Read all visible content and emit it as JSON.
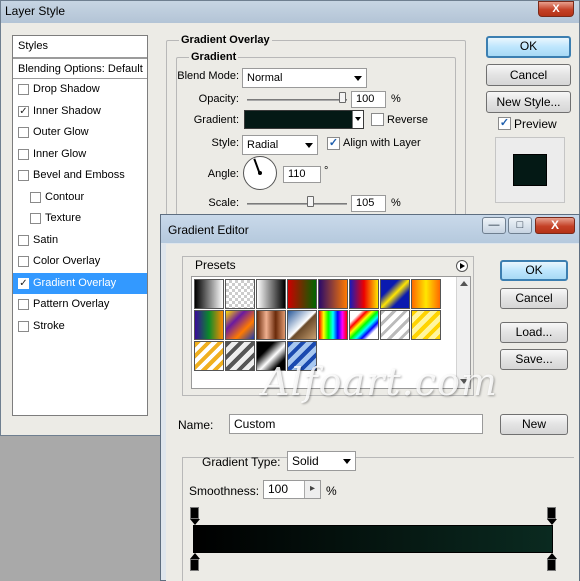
{
  "layer_style": {
    "title": "Layer Style",
    "close_glyph": "X",
    "styles_header": "Styles",
    "blending_options": "Blending Options: Default",
    "items": [
      {
        "label": "Drop Shadow",
        "checked": false,
        "indent": false
      },
      {
        "label": "Inner Shadow",
        "checked": true,
        "indent": false
      },
      {
        "label": "Outer Glow",
        "checked": false,
        "indent": false
      },
      {
        "label": "Inner Glow",
        "checked": false,
        "indent": false
      },
      {
        "label": "Bevel and Emboss",
        "checked": false,
        "indent": false
      },
      {
        "label": "Contour",
        "checked": false,
        "indent": true
      },
      {
        "label": "Texture",
        "checked": false,
        "indent": true
      },
      {
        "label": "Satin",
        "checked": false,
        "indent": false
      },
      {
        "label": "Color Overlay",
        "checked": false,
        "indent": false
      },
      {
        "label": "Gradient Overlay",
        "checked": true,
        "indent": false,
        "selected": true
      },
      {
        "label": "Pattern Overlay",
        "checked": false,
        "indent": false
      },
      {
        "label": "Stroke",
        "checked": false,
        "indent": false
      }
    ],
    "section_title": "Gradient Overlay",
    "subsection_title": "Gradient",
    "blend_mode_label": "Blend Mode:",
    "blend_mode_value": "Normal",
    "opacity_label": "Opacity:",
    "opacity_value": "100",
    "percent": "%",
    "gradient_label": "Gradient:",
    "reverse_label": "Reverse",
    "style_label": "Style:",
    "style_value": "Radial",
    "align_label": "Align with Layer",
    "angle_label": "Angle:",
    "angle_value": "110",
    "degree": "°",
    "scale_label": "Scale:",
    "scale_value": "105",
    "buttons": {
      "ok": "OK",
      "cancel": "Cancel",
      "new_style": "New Style..."
    },
    "preview_label": "Preview",
    "preview_checked": true,
    "gradient_color": "#041915"
  },
  "gradient_editor": {
    "title": "Gradient Editor",
    "minimize_glyph": "—",
    "maximize_glyph": "□",
    "close_glyph": "X",
    "presets_label": "Presets",
    "name_label": "Name:",
    "name_value": "Custom",
    "new_button": "New",
    "buttons": {
      "ok": "OK",
      "cancel": "Cancel",
      "load": "Load...",
      "save": "Save..."
    },
    "gradient_type_label": "Gradient Type:",
    "gradient_type_value": "Solid",
    "smoothness_label": "Smoothness:",
    "smoothness_value": "100",
    "smoothness_arrow": "▸",
    "percent": "%",
    "gradient_start_color": "#000000",
    "gradient_end_color": "#0a2a20",
    "presets": [
      "black-white",
      "transparent-checker",
      "black-white-dark",
      "red-green",
      "violet-orange",
      "blue-red-yellow",
      "blue-yellow-blue",
      "orange-yellow-orange",
      "violet-green-orange",
      "yellow-violet-orange-blue",
      "copper",
      "chrome",
      "spectrum",
      "transparent-rainbow",
      "transparent-stripes",
      "yellow-stripes",
      "gold-stripes",
      "silver-stripes",
      "black-white-stripes",
      "blue-stripes"
    ]
  },
  "watermark": "Alfoart.com"
}
